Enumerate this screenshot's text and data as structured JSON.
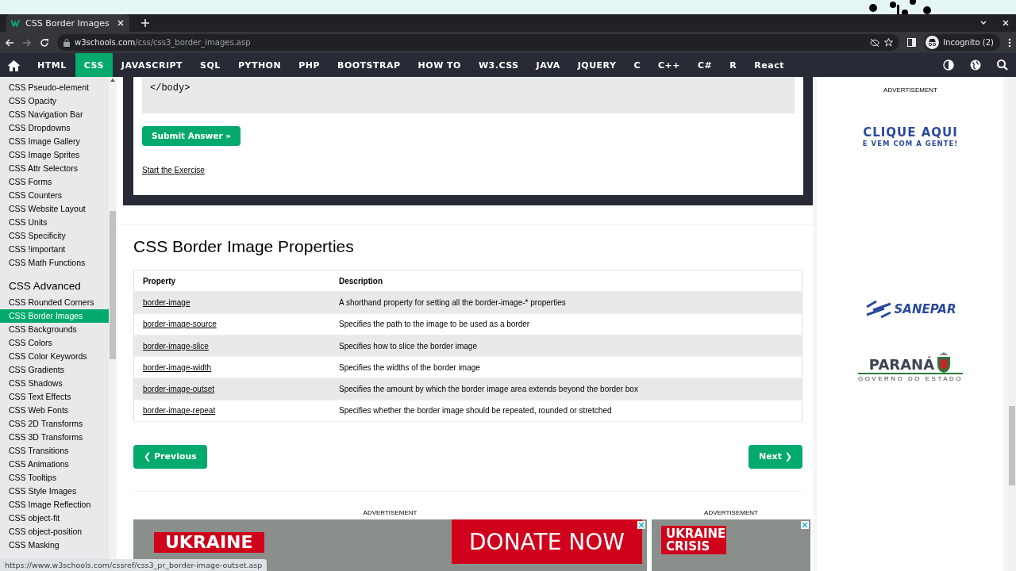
{
  "browser": {
    "tab_title": "CSS Border Images",
    "url_host": "w3schools.com",
    "url_path": "/css/css3_border_images.asp",
    "profile": "Incognito (2)"
  },
  "nav": {
    "items": [
      {
        "label": "HTML",
        "selected": false
      },
      {
        "label": "CSS",
        "selected": true
      },
      {
        "label": "JAVASCRIPT",
        "selected": false
      },
      {
        "label": "SQL",
        "selected": false
      },
      {
        "label": "PYTHON",
        "selected": false
      },
      {
        "label": "PHP",
        "selected": false
      },
      {
        "label": "BOOTSTRAP",
        "selected": false
      },
      {
        "label": "HOW TO",
        "selected": false
      },
      {
        "label": "W3.CSS",
        "selected": false
      },
      {
        "label": "JAVA",
        "selected": false
      },
      {
        "label": "JQUERY",
        "selected": false
      },
      {
        "label": "C",
        "selected": false
      },
      {
        "label": "C++",
        "selected": false
      },
      {
        "label": "C#",
        "selected": false
      },
      {
        "label": "R",
        "selected": false
      },
      {
        "label": "React",
        "selected": false
      }
    ]
  },
  "sidebar": {
    "items": [
      {
        "label": "CSS Pseudo-element",
        "selected": false
      },
      {
        "label": "CSS Opacity",
        "selected": false
      },
      {
        "label": "CSS Navigation Bar",
        "selected": false
      },
      {
        "label": "CSS Dropdowns",
        "selected": false
      },
      {
        "label": "CSS Image Gallery",
        "selected": false
      },
      {
        "label": "CSS Image Sprites",
        "selected": false
      },
      {
        "label": "CSS Attr Selectors",
        "selected": false
      },
      {
        "label": "CSS Forms",
        "selected": false
      },
      {
        "label": "CSS Counters",
        "selected": false
      },
      {
        "label": "CSS Website Layout",
        "selected": false
      },
      {
        "label": "CSS Units",
        "selected": false
      },
      {
        "label": "CSS Specificity",
        "selected": false
      },
      {
        "label": "CSS !important",
        "selected": false
      },
      {
        "label": "CSS Math Functions",
        "selected": false
      }
    ],
    "advanced": {
      "heading": "CSS Advanced",
      "items": [
        {
          "label": "CSS Rounded Corners",
          "selected": false
        },
        {
          "label": "CSS Border Images",
          "selected": true
        },
        {
          "label": "CSS Backgrounds",
          "selected": false
        },
        {
          "label": "CSS Colors",
          "selected": false
        },
        {
          "label": "CSS Color Keywords",
          "selected": false
        },
        {
          "label": "CSS Gradients",
          "selected": false
        },
        {
          "label": "CSS Shadows",
          "selected": false
        },
        {
          "label": "CSS Text Effects",
          "selected": false
        },
        {
          "label": "CSS Web Fonts",
          "selected": false
        },
        {
          "label": "CSS 2D Transforms",
          "selected": false
        },
        {
          "label": "CSS 3D Transforms",
          "selected": false
        },
        {
          "label": "CSS Transitions",
          "selected": false
        },
        {
          "label": "CSS Animations",
          "selected": false
        },
        {
          "label": "CSS Tooltips",
          "selected": false
        },
        {
          "label": "CSS Style Images",
          "selected": false
        },
        {
          "label": "CSS Image Reflection",
          "selected": false
        },
        {
          "label": "CSS object-fit",
          "selected": false
        },
        {
          "label": "CSS object-position",
          "selected": false
        },
        {
          "label": "CSS Masking",
          "selected": false
        }
      ]
    }
  },
  "exercise": {
    "code_line": "</body>",
    "submit": "Submit Answer »",
    "start_link": "Start the Exercise"
  },
  "section": {
    "title": "CSS Border Image Properties",
    "table": {
      "columns": [
        "Property",
        "Description"
      ],
      "rows": [
        {
          "property": "border-image",
          "description": "A shorthand property for setting all the border-image-* properties"
        },
        {
          "property": "border-image-source",
          "description": "Specifies the path to the image to be used as a border"
        },
        {
          "property": "border-image-slice",
          "description": "Specifies how to slice the border image"
        },
        {
          "property": "border-image-width",
          "description": "Specifies the widths of the border image"
        },
        {
          "property": "border-image-outset",
          "description": "Specifies the amount by which the border image area extends beyond the border box"
        },
        {
          "property": "border-image-repeat",
          "description": "Specifies whether the border image should be repeated, rounded or stretched"
        }
      ]
    }
  },
  "pagination": {
    "previous": "❮ Previous",
    "next": "Next ❯"
  },
  "bottom_ads": [
    {
      "label": "ADVERTISEMENT",
      "banner": "UKRAINE",
      "donate": "DONATE NOW"
    },
    {
      "label": "ADVERTISEMENT",
      "banner": "UKRAINE CRISIS"
    }
  ],
  "side_ad": {
    "label": "ADVERTISEMENT",
    "headline": "CLIQUE AQUI",
    "subline": "E VEM COM A GENTE!",
    "brand": "SANEPAR",
    "state": "PARANÁ",
    "state_sub": "GOVERNO DO ESTADO"
  },
  "status_bar": "https://www.w3schools.com/cssref/css3_pr_border-image-outset.asp"
}
